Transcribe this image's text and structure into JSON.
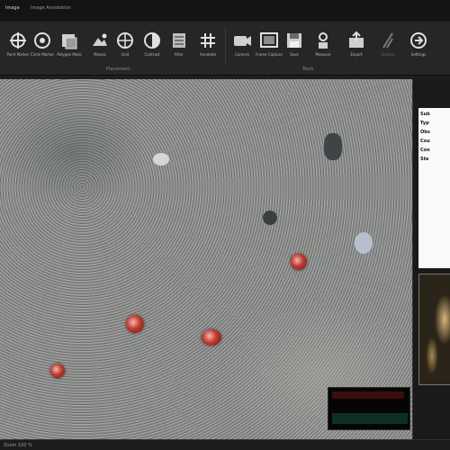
{
  "tabs": [
    {
      "label": "Image"
    },
    {
      "label": "Image Annotation"
    }
  ],
  "ribbon": {
    "groups": [
      {
        "label": "Placement"
      },
      {
        "label": "Tools"
      }
    ],
    "buttons": [
      {
        "label": "Point Marker",
        "icon": "crosshair-icon"
      },
      {
        "label": "Circle Marker",
        "icon": "circle-icon"
      },
      {
        "label": "Polygon Mask",
        "icon": "polygon-icon"
      },
      {
        "label": "Mosaic",
        "icon": "mosaic-icon"
      },
      {
        "label": "Grid",
        "icon": "grid-icon"
      },
      {
        "label": "Contrast",
        "icon": "contrast-icon"
      },
      {
        "label": "Filter",
        "icon": "filter-icon"
      },
      {
        "label": "Annotate",
        "icon": "annotate-icon"
      },
      {
        "label": "Camera",
        "icon": "camera-icon"
      },
      {
        "label": "Frame Capture",
        "icon": "frame-icon"
      },
      {
        "label": "Save",
        "icon": "save-icon"
      },
      {
        "label": "Measure",
        "icon": "measure-icon"
      },
      {
        "label": "Export",
        "icon": "export-icon"
      },
      {
        "label": "Options",
        "icon": "options-icon"
      },
      {
        "label": "Settings",
        "icon": "settings-icon"
      }
    ]
  },
  "properties": {
    "header": "",
    "rows": [
      "Sub",
      "Typ",
      "Obs",
      "Cou",
      "Con",
      "Ste"
    ]
  },
  "overlay": {
    "readout": ""
  },
  "status": {
    "text": "Zoom 100 %"
  },
  "colors": {
    "marker": "#c0392b",
    "background": "#1e1e1e",
    "ribbon": "#262626"
  }
}
